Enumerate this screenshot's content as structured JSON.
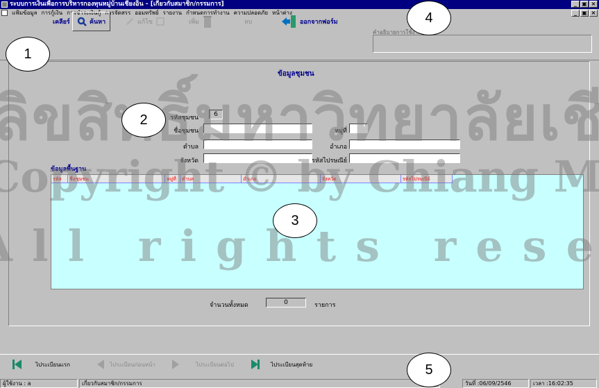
{
  "window": {
    "title": "ระบบการเงินเพื่อการบริหารกองทุนหมู่บ้านเชียงอิน - [เกี่ยวกับสมาชิก/กรรมการ]",
    "buttons": [
      "_",
      "▣",
      "×"
    ]
  },
  "menu": [
    "แฟ้มข้อมูล",
    "การกู้เงิน",
    "การชำระเงินกู้",
    "การจัดสรร",
    "ออมทรัพย์",
    "รายงาน",
    "กำหนดการทำงาน",
    "ความปลอดภัย",
    "หน้าต่าง"
  ],
  "toolbar": {
    "clear_label": "เคลียร์",
    "search_label": "ค้นหา",
    "edit_label": "แก้ไข",
    "add_label": "เพิ่ม",
    "delete_label": "ลบ",
    "exit_label": "ออกจากฟอร์ม",
    "info_title": "คำอธิบายการใช้งาน"
  },
  "form": {
    "heading": "ข้อมูลชุมชน",
    "community_code_label": "รหัสชุมชน",
    "community_code_value": "6",
    "community_name_label": "ชื่อชุมชน",
    "village_no_label": "หมู่ที่",
    "subdistrict_label": "ตำบล",
    "district_label": "อำเภอ",
    "province_label": "จังหวัด",
    "postal_label": "รหัสไปรษณีย์"
  },
  "grid": {
    "section_title": "ข้อมูลพื้นฐาน",
    "columns": [
      "รหัส",
      "ชื่อชุมชน",
      "หมู่ที่",
      "ตำบล",
      "อำเภอ",
      "จังหวัด",
      "รหัสไปรษณีย์"
    ],
    "total_label": "จำนวนทั้งหมด",
    "total_value": "0",
    "unit_label": "รายการ"
  },
  "nav": {
    "first": "ไประเบียนแรก",
    "prev": "ไประเบียนก่อนหน้า",
    "next": "ไประเบียนต่อไป",
    "last": "ไประเบียนสุดท้าย"
  },
  "status": {
    "user": "ผู้ใช้งาน : a",
    "form": "เกี่ยวกับสมาชิก/กรรมการ",
    "date": "วันที่ :06/09/2546",
    "time": "เวลา :16:02:35"
  },
  "watermark": {
    "line1": "ลิขสิทธิ์มหาวิทยาลัยเชียงใหม่",
    "line2": "Copyright © by Chiang Mai University",
    "line3": "All rights reserved"
  },
  "callouts": [
    "1",
    "2",
    "3",
    "4",
    "5"
  ],
  "colors": {
    "title_bg": "#000080",
    "grid_bg": "#c8ffff",
    "heading": "#00008b",
    "grid_header_text": "#ff0000"
  }
}
